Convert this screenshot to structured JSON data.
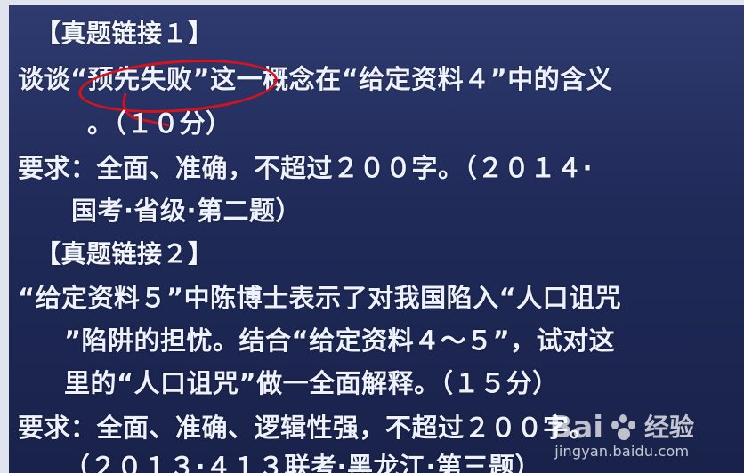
{
  "slide": {
    "lines": [
      "【真题链接１】",
      "谈谈“预先失败”这一概念在“给定资料４”中的含义",
      "。（１０分）",
      "要求：全面、准确，不超过２００字。（２０１４·",
      "国考·省级·第二题）",
      "【真题链接２】",
      "“给定资料５”中陈博士表示了对我国陷入“人口诅咒",
      "”陷阱的担忧。结合“给定资料４～５”，试对这",
      "里的“人口诅咒”做一全面解释。（１５分）",
      "要求：全面、准确、逻辑性强，不超过２００字。",
      "（２０１３·４１３联考·黑龙江·第三题）"
    ],
    "watermark": {
      "brand": "Bai",
      "brand_suffix": "经验",
      "url": "jingyan.baidu.com"
    }
  }
}
